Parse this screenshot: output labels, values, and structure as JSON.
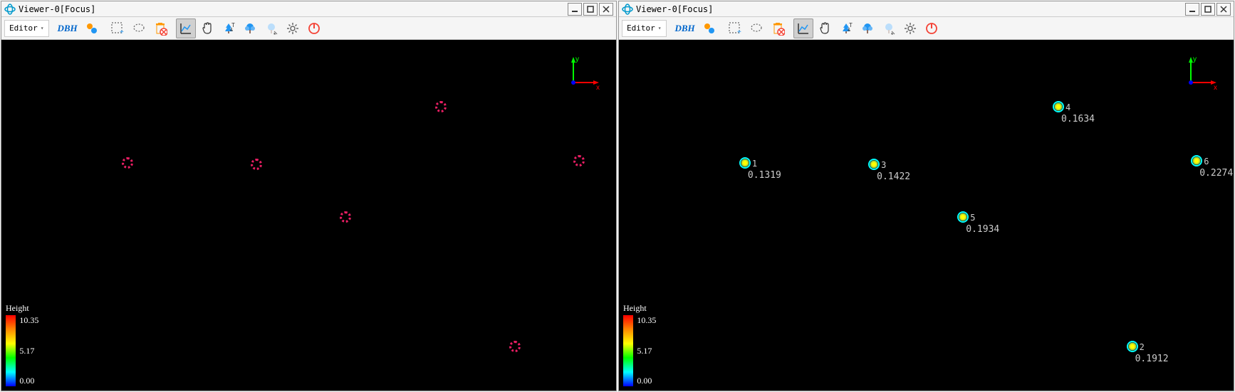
{
  "windows": [
    {
      "title": "Viewer-0[Focus]",
      "editor_label": "Editor",
      "dbh_label": "DBH",
      "legend": {
        "title": "Height",
        "max": "10.35",
        "mid": "5.17",
        "min": "0.00"
      },
      "mode": "raw",
      "points": [
        {
          "x": 20.5,
          "y": 35.0
        },
        {
          "x": 41.5,
          "y": 35.5
        },
        {
          "x": 71.5,
          "y": 19.0
        },
        {
          "x": 94.0,
          "y": 34.5
        },
        {
          "x": 56.0,
          "y": 50.5
        },
        {
          "x": 83.5,
          "y": 87.5
        }
      ]
    },
    {
      "title": "Viewer-0[Focus]",
      "editor_label": "Editor",
      "dbh_label": "DBH",
      "legend": {
        "title": "Height",
        "max": "10.35",
        "mid": "5.17",
        "min": "0.00"
      },
      "mode": "measured",
      "points": [
        {
          "x": 20.5,
          "y": 35.0,
          "id": "1",
          "val": "0.1319"
        },
        {
          "x": 41.5,
          "y": 35.5,
          "id": "3",
          "val": "0.1422"
        },
        {
          "x": 71.5,
          "y": 19.0,
          "id": "4",
          "val": "0.1634"
        },
        {
          "x": 94.0,
          "y": 34.5,
          "id": "6",
          "val": "0.2274"
        },
        {
          "x": 56.0,
          "y": 50.5,
          "id": "5",
          "val": "0.1934"
        },
        {
          "x": 83.5,
          "y": 87.5,
          "id": "2",
          "val": "0.1912"
        }
      ]
    }
  ],
  "axis": {
    "x": "x",
    "y": "y"
  }
}
